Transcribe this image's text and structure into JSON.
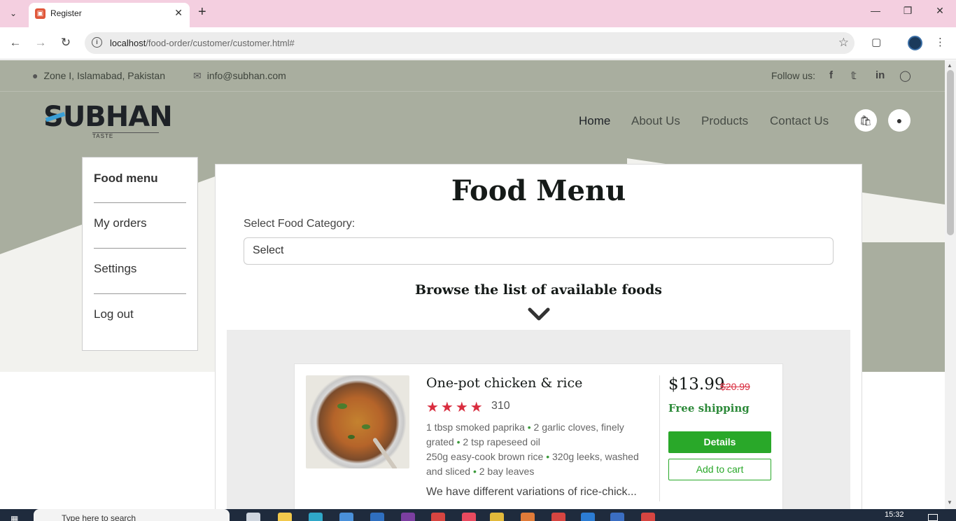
{
  "browser": {
    "tab_title": "Register",
    "url_host": "localhost",
    "url_path": "/food-order/customer/customer.html#"
  },
  "site": {
    "address": "Zone I, Islamabad, Pakistan",
    "email": "info@subhan.com",
    "follow_label": "Follow us:",
    "logo_text": "UBHAN",
    "logo_initial": "S",
    "logo_tagline": "TASTE",
    "nav": [
      {
        "label": "Home",
        "active": true
      },
      {
        "label": "About Us",
        "active": false
      },
      {
        "label": "Products",
        "active": false
      },
      {
        "label": "Contact Us",
        "active": false
      }
    ],
    "social_icons": [
      "facebook-icon",
      "twitter-icon",
      "linkedin-icon",
      "instagram-icon"
    ]
  },
  "sidebar": {
    "items": [
      {
        "label": "Food menu",
        "active": true
      },
      {
        "label": "My orders",
        "active": false
      },
      {
        "label": "Settings",
        "active": false
      },
      {
        "label": "Log out",
        "active": false
      }
    ]
  },
  "main": {
    "title": "Food Menu",
    "category_label": "Select Food Category:",
    "category_selected": "Select",
    "browse_heading": "Browse the list of available foods"
  },
  "product": {
    "title": "One-pot chicken & rice",
    "rating_stars": 4,
    "rating_count": "310",
    "ingredients_line1": [
      "1 tbsp smoked paprika",
      "2 garlic cloves, finely grated",
      "2 tsp rapeseed oil"
    ],
    "ingredients_line2": [
      "250g easy-cook brown rice",
      "320g leeks, washed and sliced",
      "2 bay leaves"
    ],
    "description": "We have different variations of rice-chick...",
    "price": "$13.99",
    "old_price": "$20.99",
    "shipping": "Free shipping",
    "details_label": "Details",
    "cart_label": "Add to cart"
  },
  "taskbar": {
    "search_placeholder": "Type here to search",
    "time": "15:32"
  },
  "colors": {
    "accent_green": "#29a829",
    "star_red": "#d92d3f",
    "hero_bg": "#a9ae9f",
    "tab_bar": "#f4cfe0"
  }
}
